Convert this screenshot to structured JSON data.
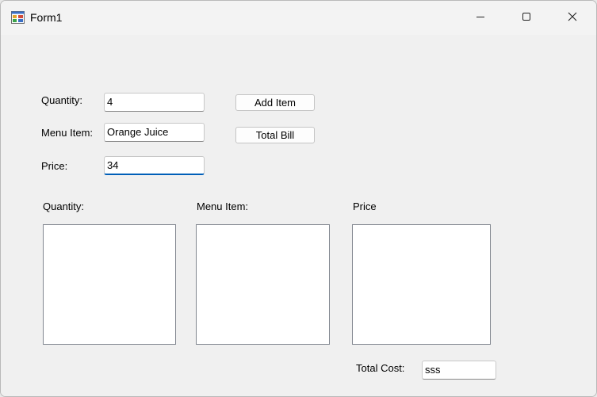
{
  "window": {
    "title": "Form1"
  },
  "icons": {
    "app": "form-app-icon",
    "minimize": "minimize-icon",
    "maximize": "maximize-icon",
    "close": "close-icon"
  },
  "form": {
    "quantity_label": "Quantity:",
    "quantity_value": "4",
    "menu_item_label": "Menu Item:",
    "menu_item_value": "Orange Juice",
    "price_label": "Price:",
    "price_value": "34",
    "add_item_button": "Add Item",
    "total_bill_button": "Total Bill"
  },
  "lists": {
    "quantity_header": "Quantity:",
    "menu_item_header": "Menu Item:",
    "price_header": "Price"
  },
  "total": {
    "label": "Total Cost:",
    "value": "sss"
  },
  "colors": {
    "focus_accent": "#005fb8"
  }
}
